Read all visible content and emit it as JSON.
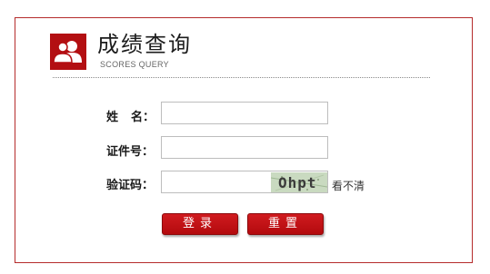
{
  "header": {
    "title": "成绩查询",
    "subtitle": "SCORES QUERY",
    "icon": "users-icon",
    "accent_color": "#b30f12"
  },
  "form": {
    "name_label_part1": "姓",
    "name_label_part2": "名：",
    "id_label": "证件号：",
    "captcha_label": "验证码：",
    "name_value": "",
    "id_value": "",
    "captcha_value": "",
    "captcha_image_text": "Ohpt",
    "refresh_link": "看不清"
  },
  "buttons": {
    "login_label": "登录",
    "reset_label": "重置",
    "color": "#c0141a"
  }
}
